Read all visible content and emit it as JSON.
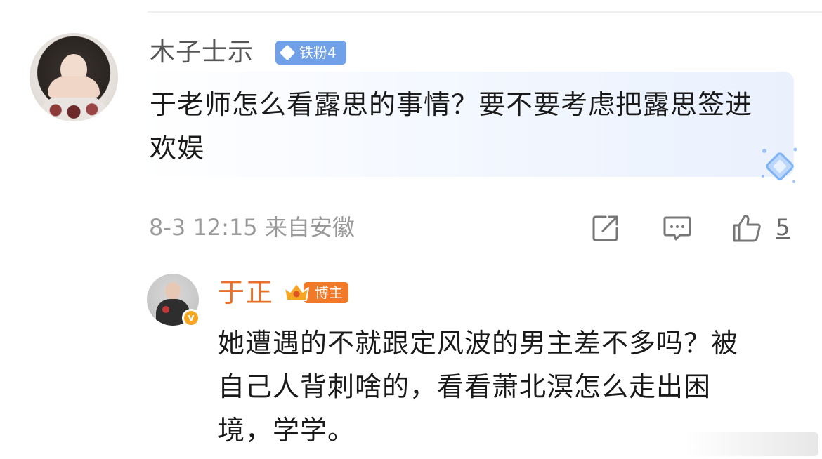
{
  "comment": {
    "username": "木子士示",
    "fan_badge": "铁粉4",
    "text": "于老师怎么看露思的事情？要不要考虑把露思签进欢娱",
    "meta": "8-3 12:15 来自安徽",
    "like_count": "5",
    "icons": {
      "share": "share-icon",
      "comment": "comment-icon",
      "like": "thumbs-up-icon"
    }
  },
  "reply": {
    "username": "于正",
    "badge": "博主",
    "verified_mark": "v",
    "text": "她遭遇的不就跟定风波的男主差不多吗？被自己人背刺啥的，看看萧北溟怎么走出困境，学学。"
  },
  "colors": {
    "reply_name": "#e8702a",
    "fan_badge": "#6fa0e8",
    "blogger_badge": "#f07a2a",
    "verified": "#f5a623"
  }
}
